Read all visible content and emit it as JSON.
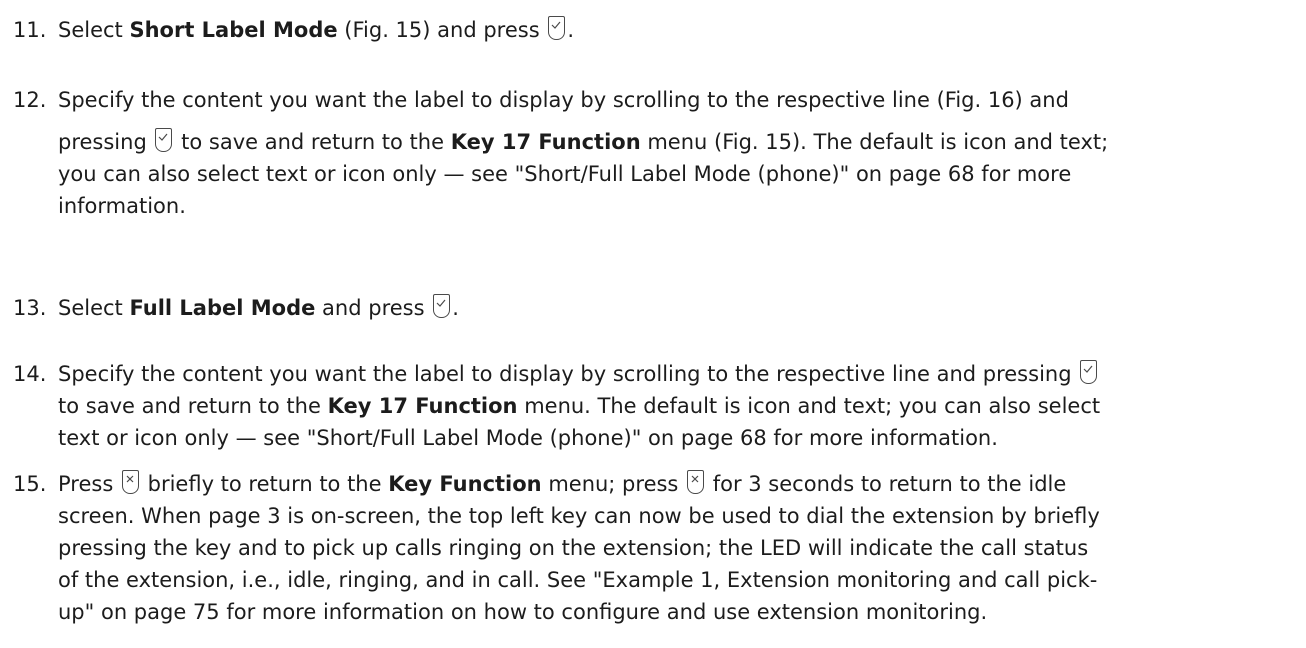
{
  "steps": [
    {
      "number": "11.",
      "parts": {
        "a": "Select ",
        "b": "Short Label Mode",
        "c": " (Fig. 15) and press ",
        "d": "."
      }
    },
    {
      "number": "12.",
      "parts": {
        "a": "Specify the content you want the label to display by scrolling to the respective line (Fig. 16) and",
        "b": "pressing ",
        "c": " to save and return to the ",
        "d": "Key 17 Function",
        "e": " menu (Fig. 15).  The default is icon and text;",
        "f": "you can also select text or icon only — see \"Short/Full Label Mode (phone)\" on page 68 for more",
        "g": "information."
      }
    },
    {
      "number": "13.",
      "parts": {
        "a": "Select ",
        "b": "Full Label Mode",
        "c": " and press ",
        "d": "."
      }
    },
    {
      "number": "14.",
      "parts": {
        "a": "Specify the content you want the label to display by scrolling to the respective line and pressing",
        "b": "to save and return to the ",
        "c": "Key 17 Function",
        "d": " menu.  The default is icon and text; you can also select",
        "e": "text or icon only — see \"Short/Full Label Mode (phone)\" on page 68 for more information."
      }
    },
    {
      "number": "15.",
      "parts": {
        "a": "Press ",
        "b": " briefly to return to the ",
        "c": "Key Function",
        "d": " menu; press ",
        "e": " for 3 seconds to return to the idle",
        "f": "screen.  When page 3 is on-screen, the top left key can now be used to dial the extension by briefly",
        "g": "pressing the key and to pick up calls ringing on the extension; the LED will indicate the call status",
        "h": "of the extension, i.e., idle, ringing, and in call.  See \"Example 1, Extension monitoring and call pick-",
        "i": "up\" on page 75 for more information on how to configure and use extension monitoring."
      }
    }
  ],
  "icons": {
    "confirm_key": "checkmark-key-icon",
    "cancel_key": "x-key-icon"
  }
}
